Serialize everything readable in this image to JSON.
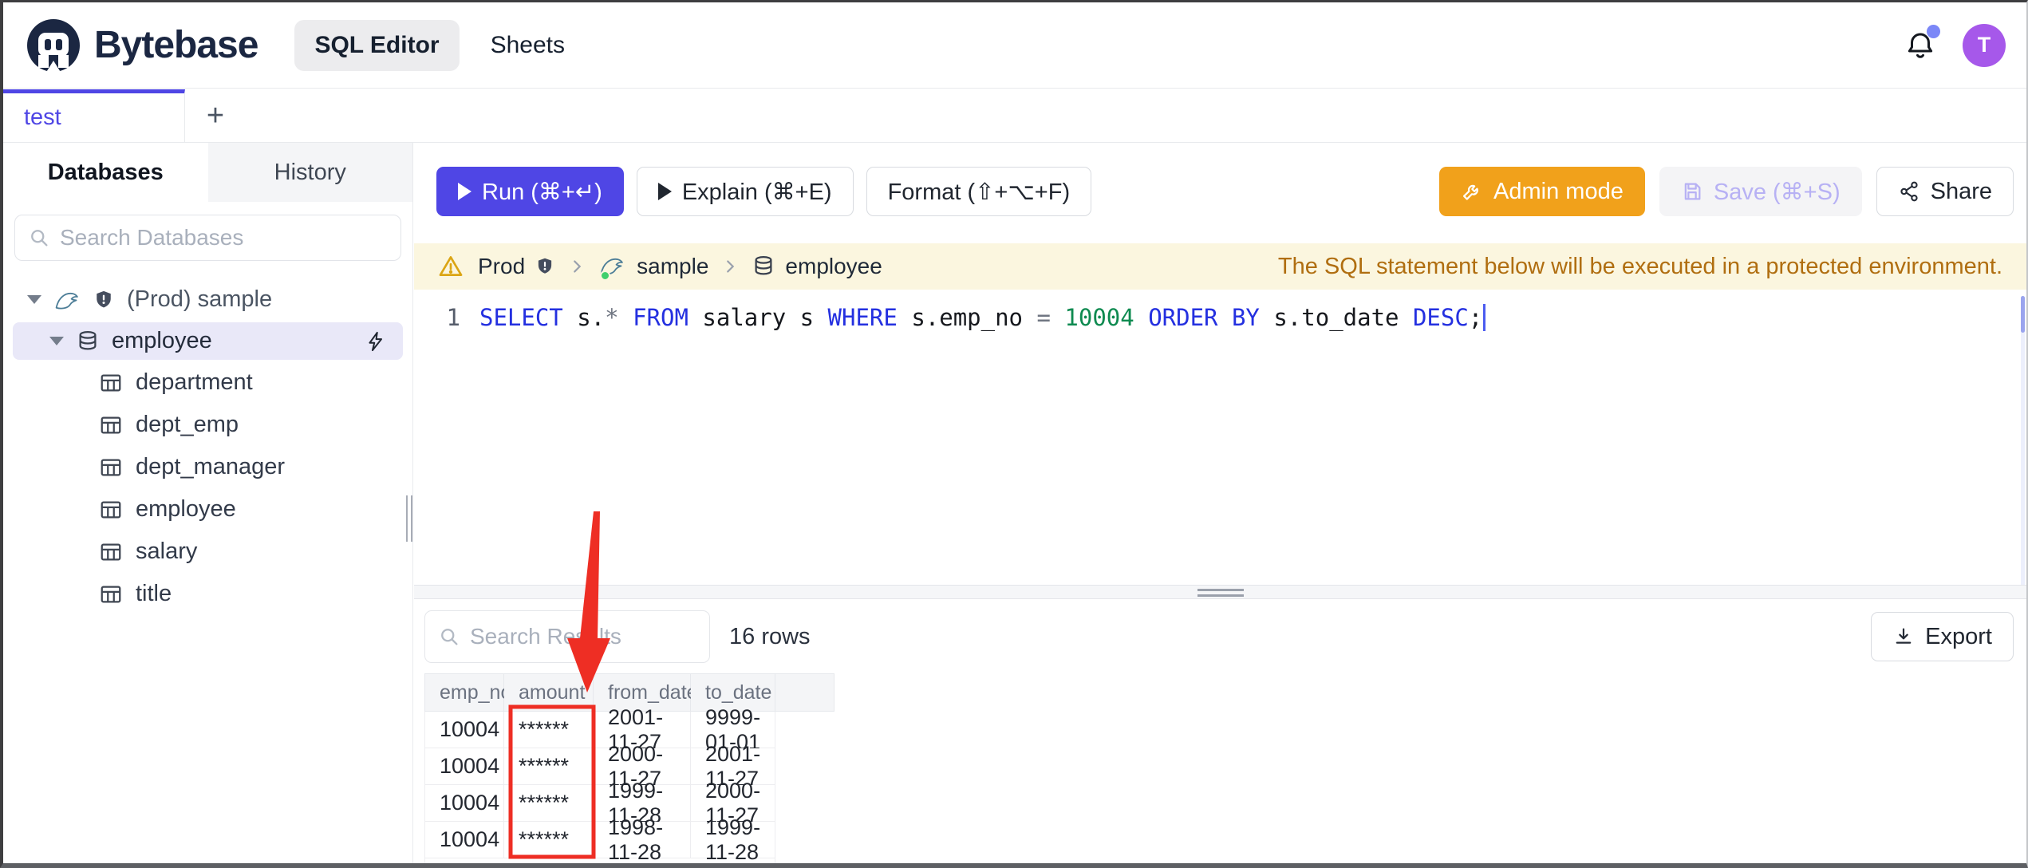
{
  "topbar": {
    "brand": "Bytebase",
    "nav_sql_editor": "SQL Editor",
    "nav_sheets": "Sheets",
    "avatar_initial": "T"
  },
  "tabbar": {
    "active_tab": "test",
    "new_tab_label": "+"
  },
  "sidebar": {
    "tabs": {
      "databases": "Databases",
      "history": "History"
    },
    "search_placeholder": "Search Databases",
    "tree": {
      "root_label": "(Prod) sample",
      "database_label": "employee",
      "tables": [
        "department",
        "dept_emp",
        "dept_manager",
        "employee",
        "salary",
        "title"
      ]
    }
  },
  "toolbar": {
    "run_label": "Run (⌘+↵)",
    "explain_label": "Explain (⌘+E)",
    "format_label": "Format (⇧+⌥+F)",
    "admin_label": "Admin mode",
    "save_label": "Save (⌘+S)",
    "share_label": "Share"
  },
  "breadcrumb": {
    "environment": "Prod",
    "instance": "sample",
    "database": "employee",
    "warning": "The SQL statement below will be executed in a protected environment."
  },
  "editor": {
    "line_number": "1",
    "tokens": [
      {
        "text": "SELECT",
        "type": "keyword"
      },
      {
        "text": " s.",
        "type": "plain"
      },
      {
        "text": "*",
        "type": "operator"
      },
      {
        "text": " ",
        "type": "plain"
      },
      {
        "text": "FROM",
        "type": "keyword"
      },
      {
        "text": " salary s ",
        "type": "plain"
      },
      {
        "text": "WHERE",
        "type": "keyword"
      },
      {
        "text": " s.emp_no ",
        "type": "plain"
      },
      {
        "text": "=",
        "type": "operator"
      },
      {
        "text": " ",
        "type": "plain"
      },
      {
        "text": "10004",
        "type": "number"
      },
      {
        "text": " ",
        "type": "plain"
      },
      {
        "text": "ORDER",
        "type": "keyword"
      },
      {
        "text": " ",
        "type": "plain"
      },
      {
        "text": "BY",
        "type": "keyword"
      },
      {
        "text": " s.to_date ",
        "type": "plain"
      },
      {
        "text": "DESC",
        "type": "keyword"
      },
      {
        "text": ";",
        "type": "plain"
      }
    ]
  },
  "results": {
    "search_placeholder": "Search Results",
    "row_count_label": "16 rows",
    "export_label": "Export",
    "table": {
      "columns": [
        "emp_no",
        "amount",
        "from_date",
        "to_date"
      ],
      "rows": [
        [
          "10004",
          "******",
          "2001-11-27",
          "9999-01-01"
        ],
        [
          "10004",
          "******",
          "2000-11-27",
          "2001-11-27"
        ],
        [
          "10004",
          "******",
          "1999-11-28",
          "2000-11-27"
        ],
        [
          "10004",
          "******",
          "1998-11-28",
          "1999-11-28"
        ]
      ]
    }
  },
  "annotation": {
    "color": "#ee2e24",
    "highlighted_column": "amount"
  },
  "colors": {
    "accent_indigo": "#4f46e5",
    "admin_orange": "#f1a11b",
    "banner_bg": "#fbf6df",
    "banner_text": "#b06e10",
    "avatar_purple": "#a658ea",
    "selected_tree_bg": "#e9e8f8",
    "annotation_red": "#ee2e24"
  }
}
